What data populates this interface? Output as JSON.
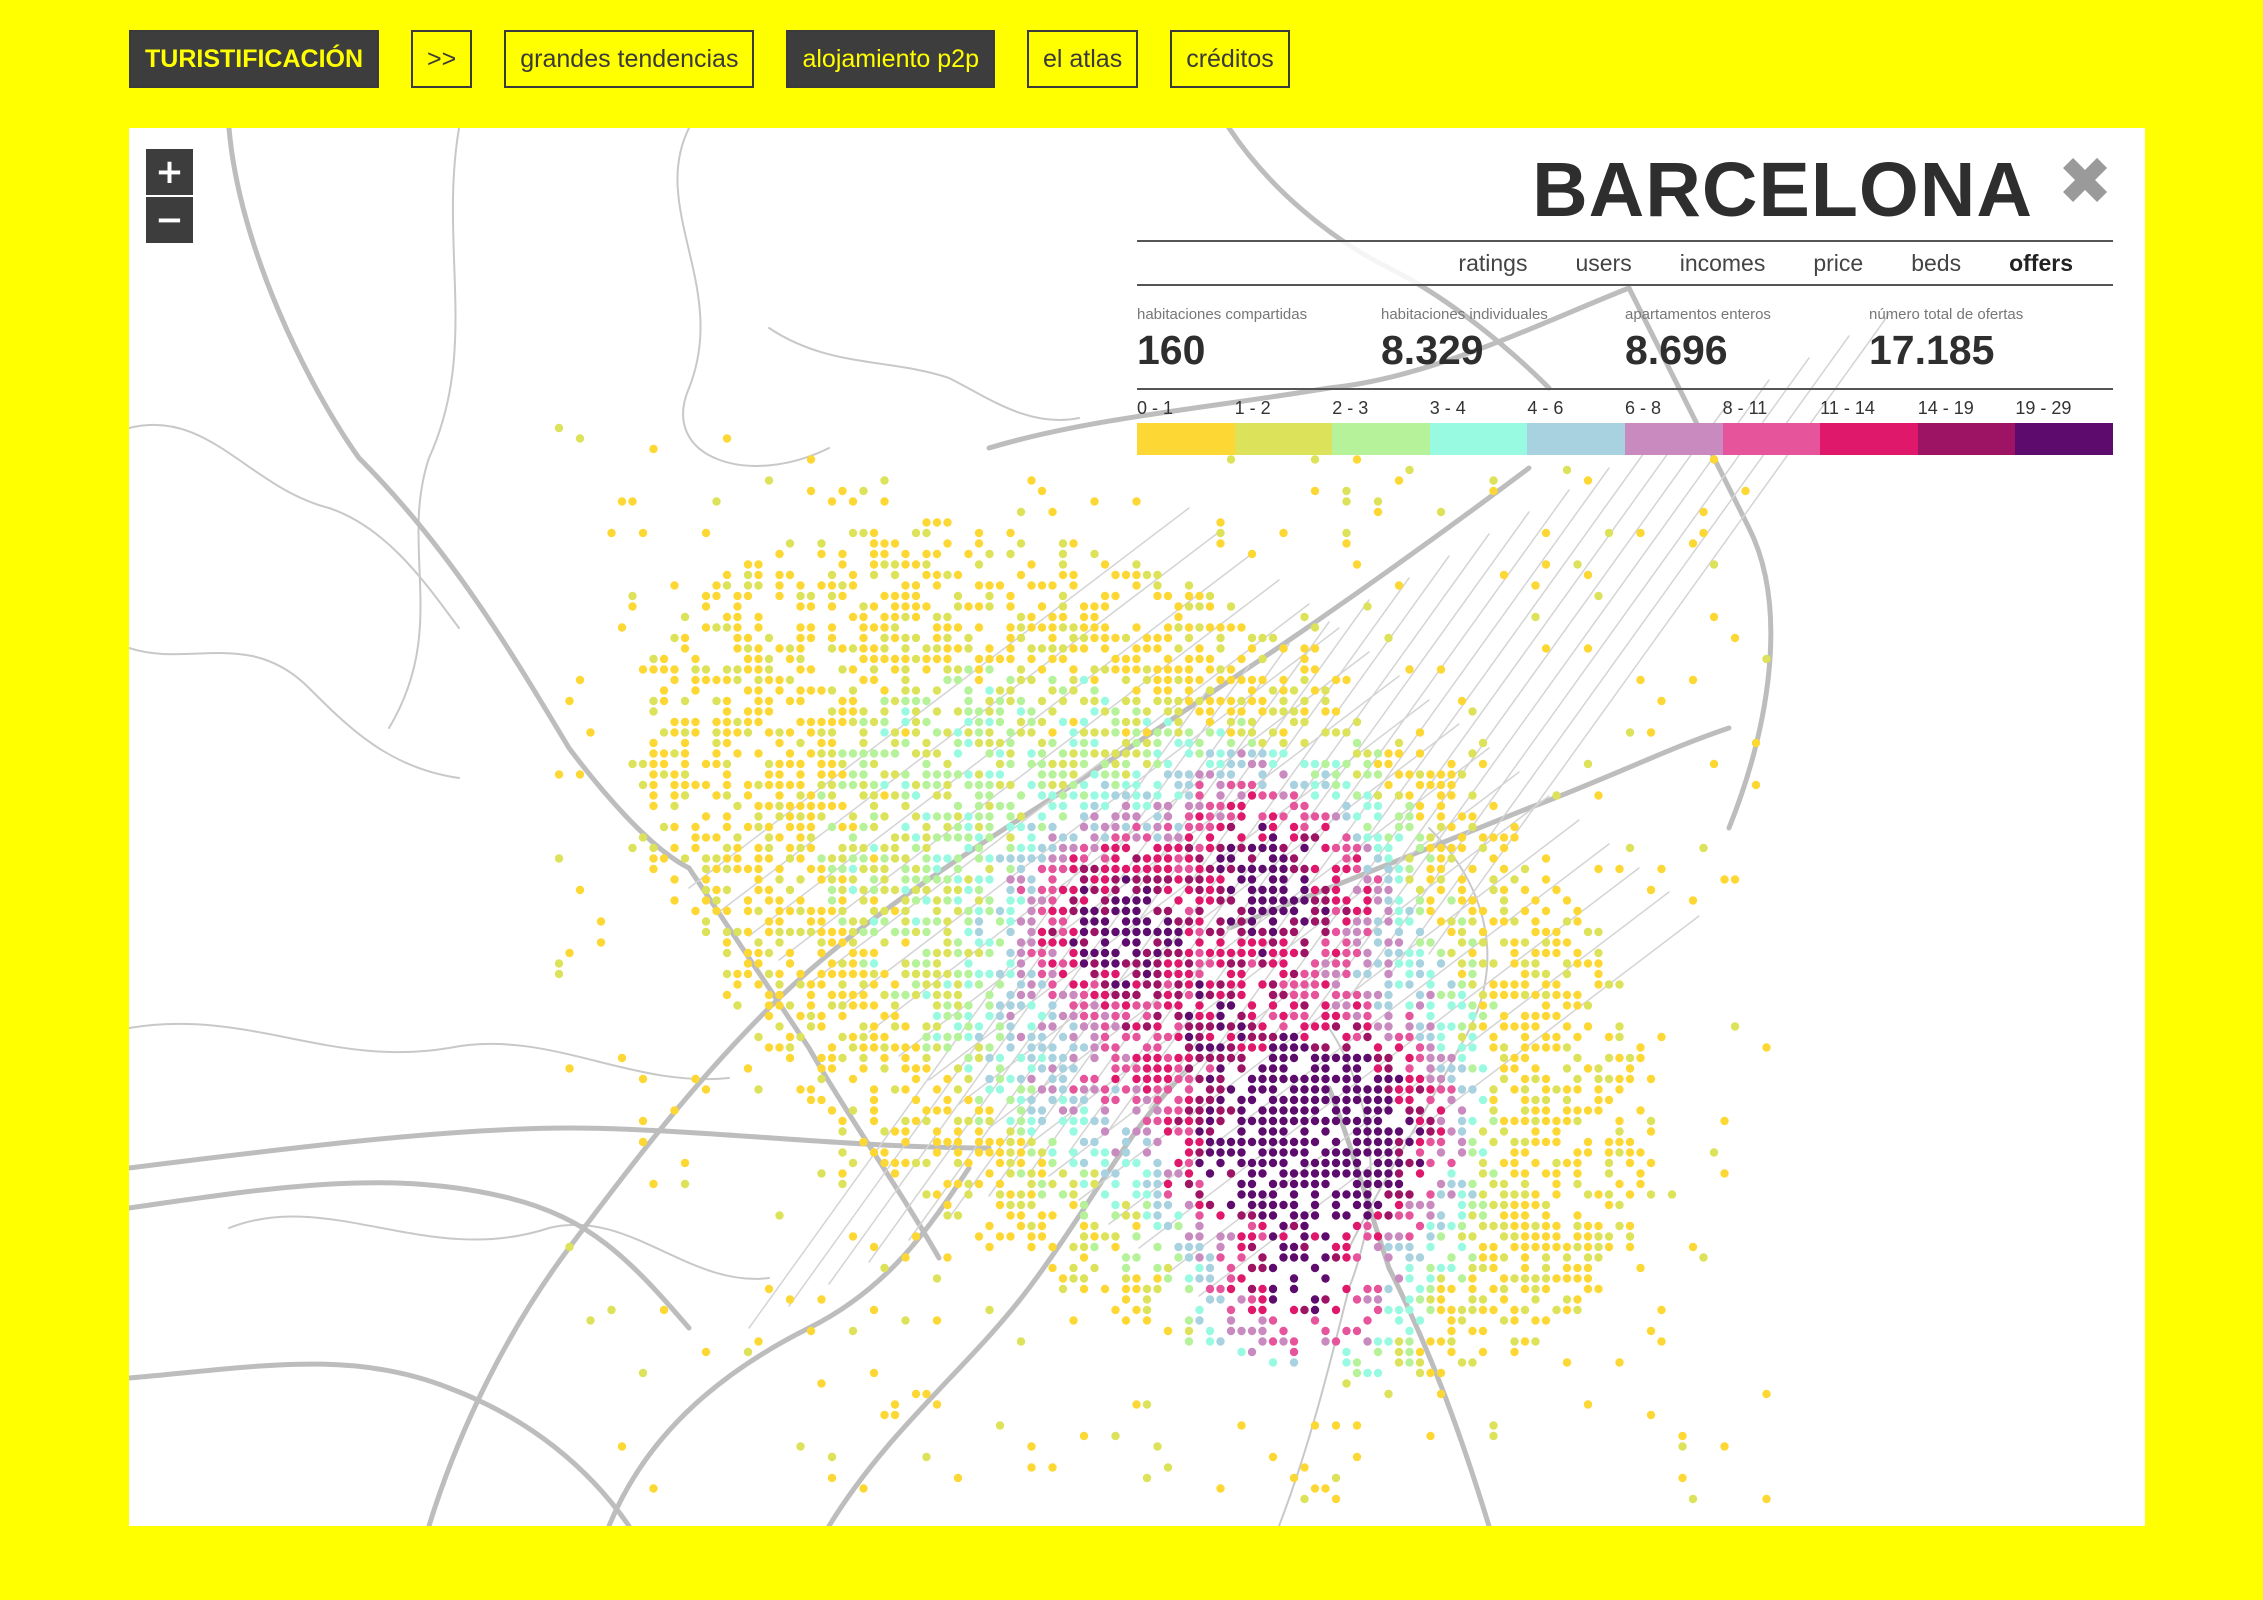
{
  "nav": [
    {
      "label": "TURISTIFICACIÓN",
      "style": "dark brand"
    },
    {
      "label": ">>",
      "style": ""
    },
    {
      "label": "grandes tendencias",
      "style": ""
    },
    {
      "label": "alojamiento p2p",
      "style": "dark"
    },
    {
      "label": "el atlas",
      "style": ""
    },
    {
      "label": "créditos",
      "style": ""
    }
  ],
  "zoom": {
    "in": "+",
    "out": "−"
  },
  "panel": {
    "city": "BARCELONA",
    "close_icon": "close-icon",
    "tabs": [
      "ratings",
      "users",
      "incomes",
      "price",
      "beds",
      "offers"
    ],
    "active_tab": "offers",
    "stats": [
      {
        "label": "habitaciones compartidas",
        "value": "160"
      },
      {
        "label": "habitaciones individuales",
        "value": "8.329"
      },
      {
        "label": "apartamentos enteros",
        "value": "8.696"
      },
      {
        "label": "número total de ofertas",
        "value": "17.185"
      }
    ],
    "legend": [
      {
        "label": "0 - 1",
        "color": "#fdd835"
      },
      {
        "label": "1 - 2",
        "color": "#dce25a"
      },
      {
        "label": "2 - 3",
        "color": "#b6f29a"
      },
      {
        "label": "3 - 4",
        "color": "#99fae2"
      },
      {
        "label": "4 - 6",
        "color": "#a8d2e0"
      },
      {
        "label": "6 - 8",
        "color": "#c98ac0"
      },
      {
        "label": "8 - 11",
        "color": "#e6559c"
      },
      {
        "label": "11 - 14",
        "color": "#e0186c"
      },
      {
        "label": "14 - 19",
        "color": "#9e1465"
      },
      {
        "label": "19 - 29",
        "color": "#5d0b6d"
      }
    ]
  }
}
